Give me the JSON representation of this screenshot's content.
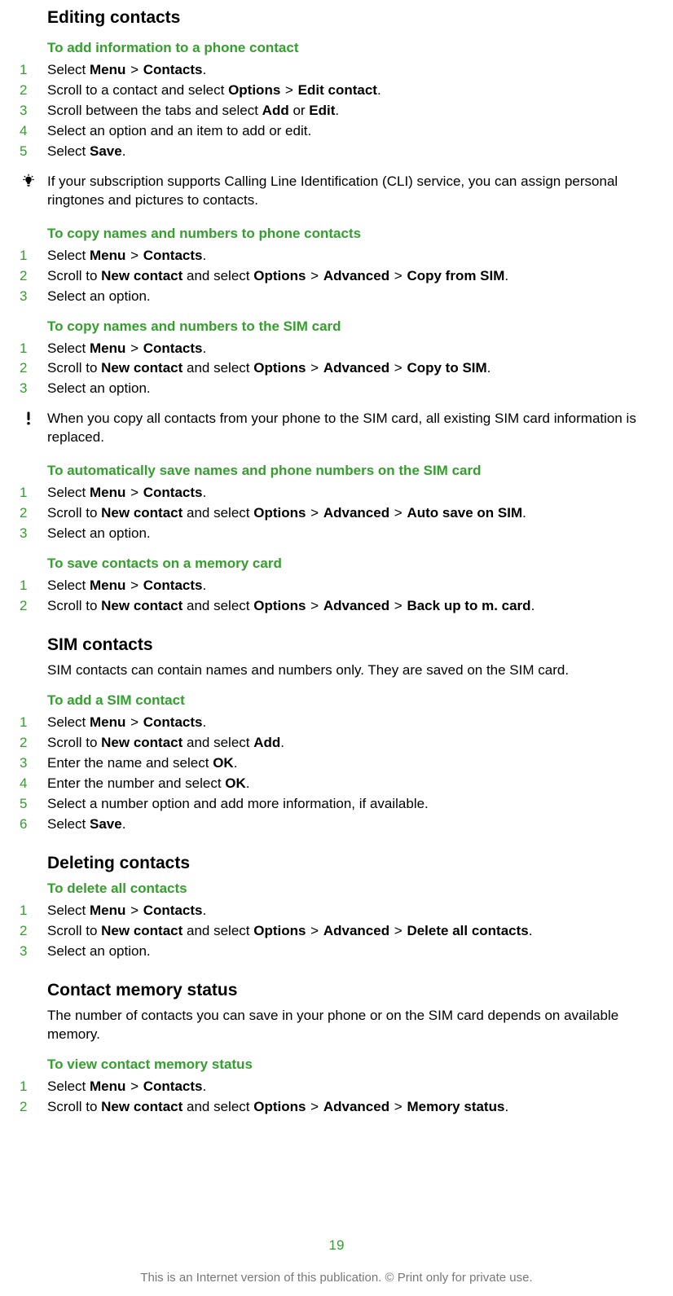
{
  "page_number": "19",
  "footer": "This is an Internet version of this publication. © Print only for private use.",
  "sections": [
    {
      "type": "h1",
      "text": "Editing contacts"
    },
    {
      "type": "h2",
      "text": "To add information to a phone contact"
    },
    {
      "type": "steps",
      "items": [
        [
          {
            "t": "Select "
          },
          {
            "t": "Menu",
            "b": true
          },
          {
            "t": " > "
          },
          {
            "t": "Contacts",
            "b": true
          },
          {
            "t": "."
          }
        ],
        [
          {
            "t": "Scroll to a contact and select "
          },
          {
            "t": "Options",
            "b": true
          },
          {
            "t": " > "
          },
          {
            "t": "Edit contact",
            "b": true
          },
          {
            "t": "."
          }
        ],
        [
          {
            "t": "Scroll between the tabs and select "
          },
          {
            "t": "Add",
            "b": true
          },
          {
            "t": " or "
          },
          {
            "t": "Edit",
            "b": true
          },
          {
            "t": "."
          }
        ],
        [
          {
            "t": "Select an option and an item to add or edit."
          }
        ],
        [
          {
            "t": "Select "
          },
          {
            "t": "Save",
            "b": true
          },
          {
            "t": "."
          }
        ]
      ]
    },
    {
      "type": "note",
      "icon": "tip",
      "text": "If your subscription supports Calling Line Identification (CLI) service, you can assign personal ringtones and pictures to contacts."
    },
    {
      "type": "h2",
      "text": "To copy names and numbers to phone contacts"
    },
    {
      "type": "steps",
      "items": [
        [
          {
            "t": "Select "
          },
          {
            "t": "Menu",
            "b": true
          },
          {
            "t": " > "
          },
          {
            "t": "Contacts",
            "b": true
          },
          {
            "t": "."
          }
        ],
        [
          {
            "t": "Scroll to "
          },
          {
            "t": "New contact",
            "b": true
          },
          {
            "t": " and select "
          },
          {
            "t": "Options",
            "b": true
          },
          {
            "t": " > "
          },
          {
            "t": "Advanced",
            "b": true
          },
          {
            "t": " > "
          },
          {
            "t": "Copy from SIM",
            "b": true
          },
          {
            "t": "."
          }
        ],
        [
          {
            "t": "Select an option."
          }
        ]
      ]
    },
    {
      "type": "h2",
      "text": "To copy names and numbers to the SIM card"
    },
    {
      "type": "steps",
      "items": [
        [
          {
            "t": "Select "
          },
          {
            "t": "Menu",
            "b": true
          },
          {
            "t": " > "
          },
          {
            "t": "Contacts",
            "b": true
          },
          {
            "t": "."
          }
        ],
        [
          {
            "t": "Scroll to "
          },
          {
            "t": "New contact",
            "b": true
          },
          {
            "t": " and select "
          },
          {
            "t": "Options",
            "b": true
          },
          {
            "t": " > "
          },
          {
            "t": "Advanced",
            "b": true
          },
          {
            "t": " > "
          },
          {
            "t": "Copy to SIM",
            "b": true
          },
          {
            "t": "."
          }
        ],
        [
          {
            "t": "Select an option."
          }
        ]
      ]
    },
    {
      "type": "note",
      "icon": "warn",
      "text": "When you copy all contacts from your phone to the SIM card, all existing SIM card information is replaced."
    },
    {
      "type": "h2",
      "text": "To automatically save names and phone numbers on the SIM card"
    },
    {
      "type": "steps",
      "items": [
        [
          {
            "t": "Select "
          },
          {
            "t": "Menu",
            "b": true
          },
          {
            "t": " > "
          },
          {
            "t": "Contacts",
            "b": true
          },
          {
            "t": "."
          }
        ],
        [
          {
            "t": "Scroll to "
          },
          {
            "t": "New contact",
            "b": true
          },
          {
            "t": " and select "
          },
          {
            "t": "Options",
            "b": true
          },
          {
            "t": " > "
          },
          {
            "t": "Advanced",
            "b": true
          },
          {
            "t": " > "
          },
          {
            "t": "Auto save on SIM",
            "b": true
          },
          {
            "t": "."
          }
        ],
        [
          {
            "t": "Select an option."
          }
        ]
      ]
    },
    {
      "type": "h2",
      "text": "To save contacts on a memory card"
    },
    {
      "type": "steps",
      "items": [
        [
          {
            "t": "Select "
          },
          {
            "t": "Menu",
            "b": true
          },
          {
            "t": " > "
          },
          {
            "t": "Contacts",
            "b": true
          },
          {
            "t": "."
          }
        ],
        [
          {
            "t": "Scroll to "
          },
          {
            "t": "New contact",
            "b": true
          },
          {
            "t": " and select "
          },
          {
            "t": "Options",
            "b": true
          },
          {
            "t": " > "
          },
          {
            "t": "Advanced",
            "b": true
          },
          {
            "t": " > "
          },
          {
            "t": "Back up to m. card",
            "b": true
          },
          {
            "t": "."
          }
        ]
      ]
    },
    {
      "type": "h1-section",
      "text": "SIM contacts"
    },
    {
      "type": "body",
      "text": "SIM contacts can contain names and numbers only. They are saved on the SIM card."
    },
    {
      "type": "h2",
      "text": "To add a SIM contact"
    },
    {
      "type": "steps",
      "items": [
        [
          {
            "t": "Select "
          },
          {
            "t": "Menu",
            "b": true
          },
          {
            "t": " > "
          },
          {
            "t": "Contacts",
            "b": true
          },
          {
            "t": "."
          }
        ],
        [
          {
            "t": "Scroll to "
          },
          {
            "t": "New contact",
            "b": true
          },
          {
            "t": " and select "
          },
          {
            "t": "Add",
            "b": true
          },
          {
            "t": "."
          }
        ],
        [
          {
            "t": "Enter the name and select "
          },
          {
            "t": "OK",
            "b": true
          },
          {
            "t": "."
          }
        ],
        [
          {
            "t": "Enter the number and select "
          },
          {
            "t": "OK",
            "b": true
          },
          {
            "t": "."
          }
        ],
        [
          {
            "t": "Select a number option and add more information, if available."
          }
        ],
        [
          {
            "t": "Select "
          },
          {
            "t": "Save",
            "b": true
          },
          {
            "t": "."
          }
        ]
      ]
    },
    {
      "type": "h1-section",
      "text": "Deleting contacts"
    },
    {
      "type": "h2",
      "text": "To delete all contacts"
    },
    {
      "type": "steps",
      "items": [
        [
          {
            "t": "Select "
          },
          {
            "t": "Menu",
            "b": true
          },
          {
            "t": " > "
          },
          {
            "t": "Contacts",
            "b": true
          },
          {
            "t": "."
          }
        ],
        [
          {
            "t": "Scroll to "
          },
          {
            "t": "New contact",
            "b": true
          },
          {
            "t": " and select "
          },
          {
            "t": "Options",
            "b": true
          },
          {
            "t": " > "
          },
          {
            "t": "Advanced",
            "b": true
          },
          {
            "t": " > "
          },
          {
            "t": "Delete all contacts",
            "b": true
          },
          {
            "t": "."
          }
        ],
        [
          {
            "t": "Select an option."
          }
        ]
      ]
    },
    {
      "type": "h1-section",
      "text": "Contact memory status"
    },
    {
      "type": "body",
      "text": "The number of contacts you can save in your phone or on the SIM card depends on available memory."
    },
    {
      "type": "h2",
      "text": "To view contact memory status"
    },
    {
      "type": "steps",
      "items": [
        [
          {
            "t": "Select "
          },
          {
            "t": "Menu",
            "b": true
          },
          {
            "t": " > "
          },
          {
            "t": "Contacts",
            "b": true
          },
          {
            "t": "."
          }
        ],
        [
          {
            "t": "Scroll to "
          },
          {
            "t": "New contact",
            "b": true
          },
          {
            "t": " and select "
          },
          {
            "t": "Options",
            "b": true
          },
          {
            "t": " > "
          },
          {
            "t": "Advanced",
            "b": true
          },
          {
            "t": " > "
          },
          {
            "t": "Memory status",
            "b": true
          },
          {
            "t": "."
          }
        ]
      ]
    }
  ]
}
